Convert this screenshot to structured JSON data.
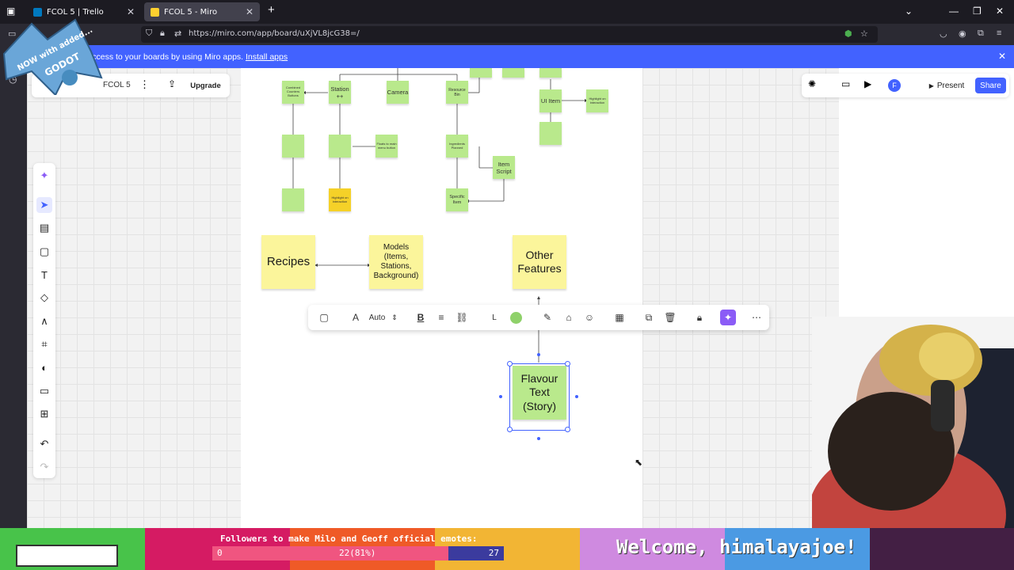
{
  "browser": {
    "tabs": [
      {
        "label": "FCOL 5 | Trello"
      },
      {
        "label": "FCOL 5 - Miro"
      }
    ],
    "new_tab": "+",
    "url": "https://miro.com/app/board/uXjVL8jcG38=/"
  },
  "banner": {
    "text": "r access to your boards by using Miro apps.",
    "link": "Install apps"
  },
  "board": {
    "name": "FCOL 5",
    "upgrade": "Upgrade"
  },
  "topright": {
    "present": "Present",
    "share": "Share",
    "avatar": "F"
  },
  "stickies": {
    "combined": "Combined Counters Buttons",
    "station": "Station ++",
    "camera": "Camera",
    "resource": "Resource Bin",
    "ui_item": "UI Item",
    "highlight1": "Highlight on interaction",
    "floater": "Floats to main menu button",
    "ingredients": "Ingredients Planned",
    "item_script": "Item Script",
    "specific_item": "Specific Item",
    "highlight_gold": "Highlight on interaction",
    "recipes": "Recipes",
    "models": "Models (Items, Stations, Background)",
    "other": "Other Features",
    "flavour": "Flavour Text (Story)"
  },
  "context_toolbar": {
    "font_size": "Auto",
    "size": "L",
    "color": "#8fd16a"
  },
  "overlay": {
    "goal_title": "Followers to make Milo and Geoff official emotes:",
    "goal_start": "0",
    "goal_current": "22(81%)",
    "goal_target": "27",
    "goal_fraction": 0.81,
    "welcome": "Welcome, himalayajoe!",
    "badge_line1": "NOW with added...",
    "badge_line2": "GODOT"
  },
  "colors": {
    "miro_blue": "#4262ff",
    "sticky_green": "#b9e98c",
    "sticky_yellow": "#fbf59b"
  }
}
